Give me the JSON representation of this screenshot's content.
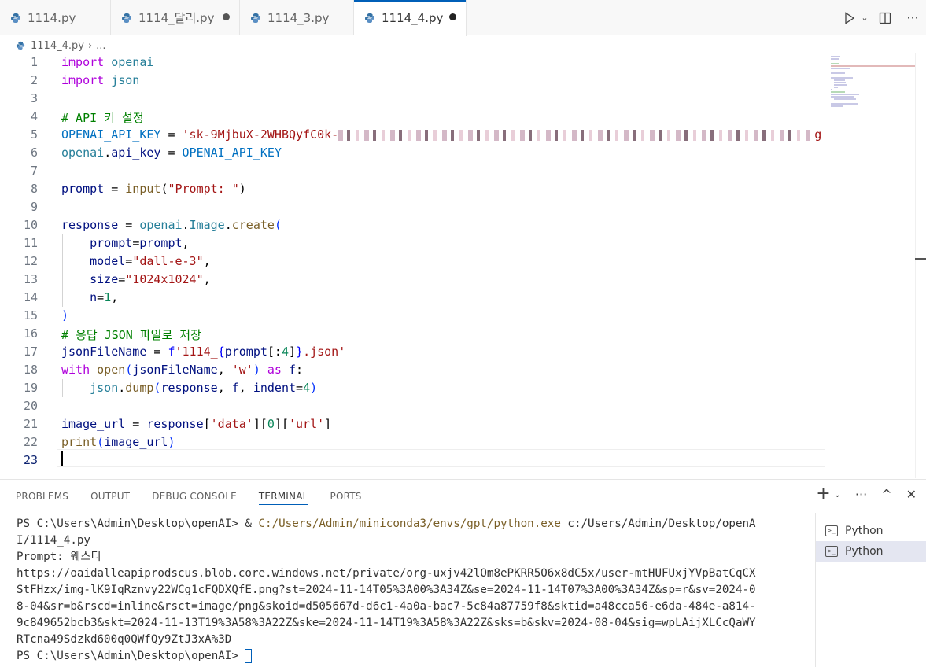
{
  "tabs": [
    {
      "label": "1114.py",
      "modified": false,
      "active": false
    },
    {
      "label": "1114_달리.py",
      "modified": true,
      "active": false
    },
    {
      "label": "1114_3.py",
      "modified": false,
      "active": false
    },
    {
      "label": "1114_4.py",
      "modified": true,
      "active": true
    }
  ],
  "toolbar": {
    "run_icon": "play-icon",
    "split_icon": "split-editor-icon",
    "more_icon": "more-icon"
  },
  "breadcrumb": {
    "file": "1114_4.py",
    "more": "..."
  },
  "editor": {
    "line_numbers": [
      "1",
      "2",
      "3",
      "4",
      "5",
      "6",
      "7",
      "8",
      "9",
      "10",
      "11",
      "12",
      "13",
      "14",
      "15",
      "16",
      "17",
      "18",
      "19",
      "20",
      "21",
      "22",
      "23"
    ],
    "current_line": "23",
    "code": {
      "l1_kw": "import",
      "l1_mod": "openai",
      "l2_kw": "import",
      "l2_mod": "json",
      "l4": "# API 키 설정",
      "l5_var": "OPENAI_API_KEY",
      "l5_eq": " = ",
      "l5_str": "'sk-9MjbuX-2WHBQyfC0k-",
      "l5_tail": "g",
      "l6_mod": "openai",
      "l6_dot": ".",
      "l6_attr": "api_key",
      "l6_eq": " = ",
      "l6_const": "OPENAI_API_KEY",
      "l8_var": "prompt",
      "l8_eq": " = ",
      "l8_fn": "input",
      "l8_open": "(",
      "l8_str": "\"Prompt: \"",
      "l8_close": ")",
      "l10_var": "response",
      "l10_eq": " = ",
      "l10_mod": "openai",
      "l10_dot": ".",
      "l10_cls": "Image",
      "l10_dot2": ".",
      "l10_fn": "create",
      "l10_open": "(",
      "l11_param": "prompt",
      "l11_eq": "=",
      "l11_val": "prompt",
      "l11_comma": ",",
      "l12_param": "model",
      "l12_eq": "=",
      "l12_str": "\"dall-e-3\"",
      "l12_comma": ",",
      "l13_param": "size",
      "l13_eq": "=",
      "l13_str": "\"1024x1024\"",
      "l13_comma": ",",
      "l14_param": "n",
      "l14_eq": "=",
      "l14_num": "1",
      "l14_comma": ",",
      "l15": ")",
      "l16": "# 응답 JSON 파일로 저장",
      "l17_var": "jsonFileName",
      "l17_eq": " = ",
      "l17_f": "f",
      "l17_s1": "'1114_",
      "l17_b1": "{",
      "l17_expr": "prompt",
      "l17_idx": "[:",
      "l17_num": "4",
      "l17_idx2": "]",
      "l17_b2": "}",
      "l17_s2": ".json'",
      "l18_kw": "with",
      "l18_fn": "open",
      "l18_open": "(",
      "l18_var": "jsonFileName",
      "l18_comma": ", ",
      "l18_str": "'w'",
      "l18_close": ")",
      "l18_as": "as",
      "l18_f": "f",
      "l18_colon": ":",
      "l19_mod": "json",
      "l19_dot": ".",
      "l19_fn": "dump",
      "l19_open": "(",
      "l19_a1": "response",
      "l19_c1": ", ",
      "l19_a2": "f",
      "l19_c2": ", ",
      "l19_param": "indent",
      "l19_eq": "=",
      "l19_num": "4",
      "l19_close": ")",
      "l21_var": "image_url",
      "l21_eq": " = ",
      "l21_obj": "response",
      "l21_b1": "[",
      "l21_s1": "'data'",
      "l21_b2": "][",
      "l21_num": "0",
      "l21_b3": "][",
      "l21_s2": "'url'",
      "l21_b4": "]",
      "l22_fn": "print",
      "l22_open": "(",
      "l22_var": "image_url",
      "l22_close": ")"
    }
  },
  "panel": {
    "tabs": [
      "PROBLEMS",
      "OUTPUT",
      "DEBUG CONSOLE",
      "TERMINAL",
      "PORTS"
    ],
    "active_tab": "TERMINAL",
    "actions": {
      "add": "+",
      "dropdown": "⌄",
      "more": "···",
      "maximize": "^",
      "close": "✕"
    },
    "terminal": {
      "l1_prefix": "PS C:\\Users\\Admin\\Desktop\\openAI> & ",
      "l1_exe": "C:/Users/Admin/miniconda3/envs/gpt/python.exe",
      "l1_rest": " c:/Users/Admin/Desktop/openA",
      "l2": "I/1114_4.py",
      "l3": "Prompt: 웨스티",
      "l4": "https://oaidalleapiprodscus.blob.core.windows.net/private/org-uxjv42lOm8ePKRR5O6x8dC5x/user-mtHUFUxjYVpBatCqCX",
      "l5": "StFHzx/img-lK9IqRznvy22WCg1cFQDXQfE.png?st=2024-11-14T05%3A00%3A34Z&se=2024-11-14T07%3A00%3A34Z&sp=r&sv=2024-0",
      "l6": "8-04&sr=b&rscd=inline&rsct=image/png&skoid=d505667d-d6c1-4a0a-bac7-5c84a87759f8&sktid=a48cca56-e6da-484e-a814-",
      "l7": "9c849652bcb3&skt=2024-11-13T19%3A58%3A22Z&ske=2024-11-14T19%3A58%3A22Z&sks=b&skv=2024-08-04&sig=wpLAijXLCcQaWY",
      "l8": "RTcna49Sdzkd600q0QWfQy9ZtJ3xA%3D",
      "l9": "PS C:\\Users\\Admin\\Desktop\\openAI> "
    },
    "terminals": [
      "Python",
      "Python"
    ],
    "selected_terminal": 1
  }
}
